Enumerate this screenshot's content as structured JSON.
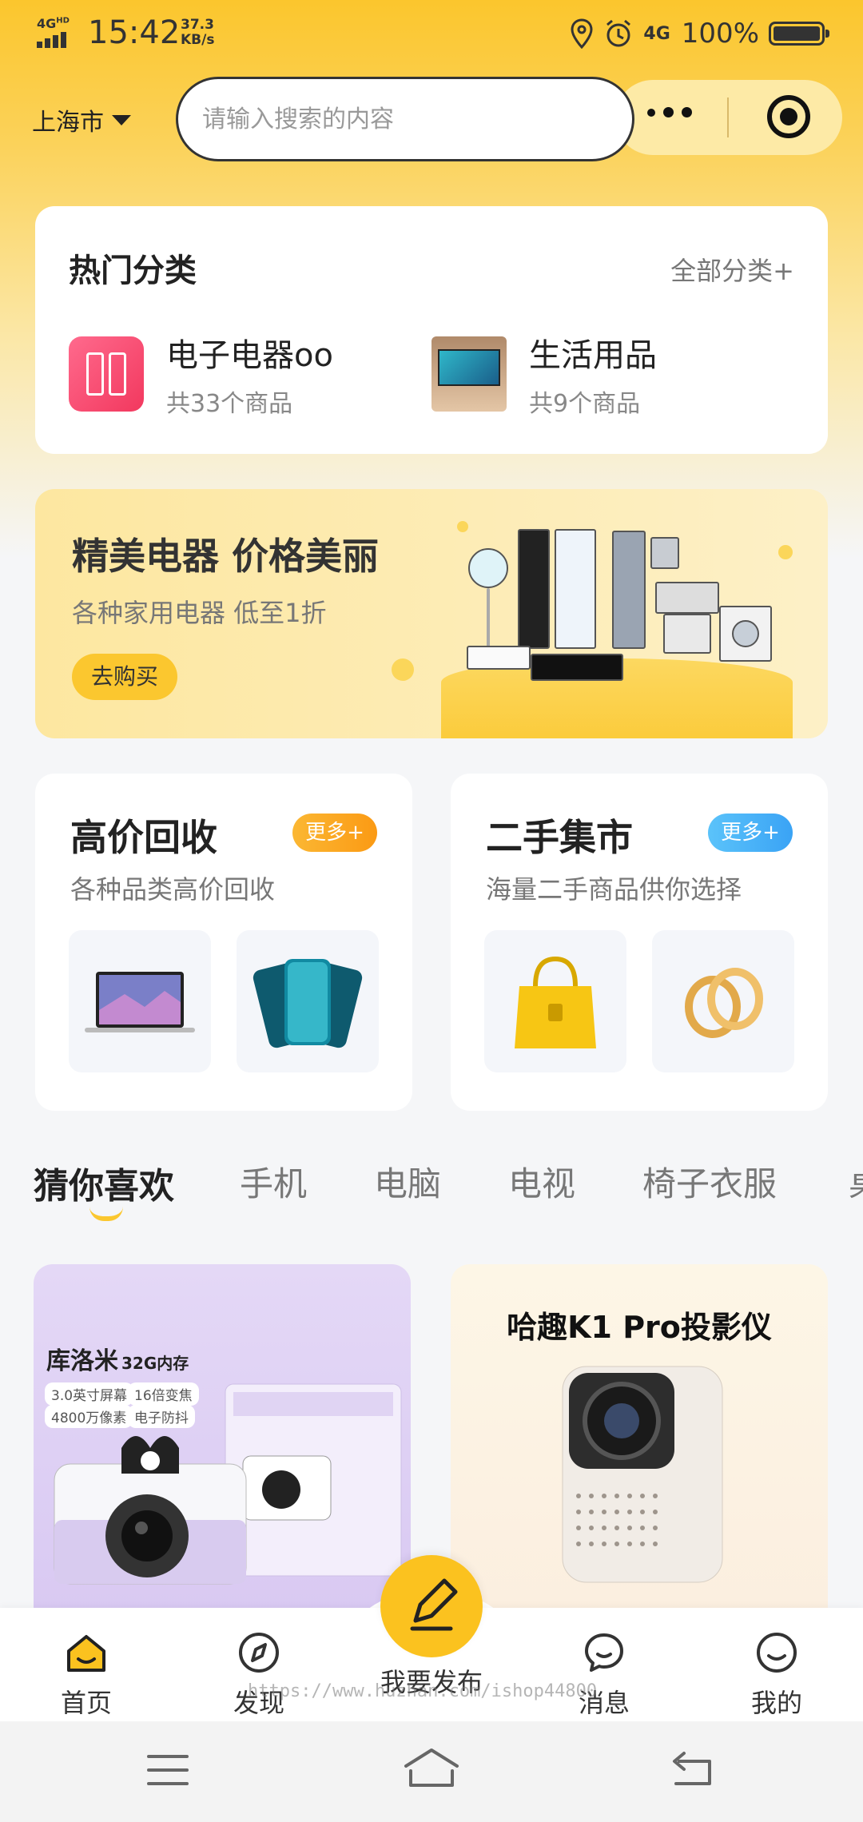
{
  "status_bar": {
    "network": "4G",
    "network_sup": "HD",
    "time": "15:42",
    "speed_value": "37.3",
    "speed_unit": "KB/s",
    "network_right": "4G",
    "battery": "100%"
  },
  "header": {
    "city": "上海市",
    "search_placeholder": "请输入搜索的内容"
  },
  "hot_categories": {
    "title": "热门分类",
    "all_link": "全部分类+",
    "items": [
      {
        "name": "电子电器oo",
        "count": "共33个商品",
        "icon": "refrigerator-icon"
      },
      {
        "name": "生活用品",
        "count": "共9个商品",
        "icon": "tv-photo"
      }
    ]
  },
  "banner": {
    "title": "精美电器 价格美丽",
    "subtitle": "各种家用电器 低至1折",
    "button": "去购买"
  },
  "promos": [
    {
      "title": "高价回收",
      "subtitle": "各种品类高价回收",
      "badge": "更多+",
      "badge_color": "#fba51d"
    },
    {
      "title": "二手集市",
      "subtitle": "海量二手商品供你选择",
      "badge": "更多+",
      "badge_color": "#4bb4f8"
    }
  ],
  "tabs": [
    "猜你喜欢",
    "手机",
    "电脑",
    "电视",
    "椅子衣服",
    "桌"
  ],
  "products": [
    {
      "brand_title": "库洛米",
      "brand_sub": "32G内存",
      "specs": [
        "3.0英寸屏幕",
        "16倍变焦",
        "4800万像素",
        "电子防抖"
      ]
    },
    {
      "title": "哈趣K1 Pro投影仪"
    }
  ],
  "bottom_nav": {
    "items": [
      {
        "label": "首页",
        "icon": "home-icon"
      },
      {
        "label": "发现",
        "icon": "compass-icon"
      },
      {
        "label": "我要发布",
        "icon": "pencil-icon"
      },
      {
        "label": "消息",
        "icon": "chat-icon"
      },
      {
        "label": "我的",
        "icon": "smiley-icon"
      }
    ],
    "watermark": "https://www.huzhan.com/ishop44800"
  },
  "colors": {
    "accent": "#fbc72f",
    "badge_orange": "#fba51d",
    "badge_blue": "#4bb4f8"
  }
}
